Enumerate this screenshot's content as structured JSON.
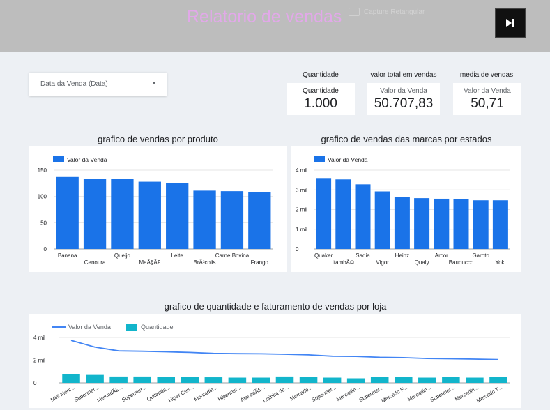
{
  "header": {
    "title": "Relatorio de vendas",
    "ghost_label": "Capture Retangular"
  },
  "filter": {
    "label": "Data da Venda (Data)"
  },
  "kpis": [
    {
      "heading": "Quantidade",
      "label": "Quantidade",
      "value": "1.000"
    },
    {
      "heading": "valor total em vendas",
      "label": "Valor da Venda",
      "value": "50.707,83"
    },
    {
      "heading": "media de vendas",
      "label": "Valor da Venda",
      "value": "50,71"
    }
  ],
  "colors": {
    "bar_blue": "#1a73e8",
    "teal": "#12b5cb",
    "line_blue": "#4285f4"
  },
  "chart_data": [
    {
      "type": "bar",
      "title": "grafico de vendas por produto",
      "legend": "Valor da Venda",
      "categories": [
        "Banana",
        "Cenoura",
        "Queijo",
        "MaÃ§Ã£",
        "Leite",
        "BrÃ³colis",
        "Carne Bovina",
        "Frango"
      ],
      "values": [
        137,
        134,
        134,
        128,
        125,
        111,
        110,
        108
      ],
      "yticks": [
        "0",
        "50",
        "100",
        "150"
      ],
      "ylim": [
        0,
        150
      ]
    },
    {
      "type": "bar",
      "title": "grafico de vendas das marcas por estados",
      "legend": "Valor da Venda",
      "categories": [
        "Quaker",
        "ItambÃ©",
        "Sadia",
        "Vigor",
        "Heinz",
        "Qualy",
        "Arcor",
        "Bauducco",
        "Garoto",
        "Yoki"
      ],
      "values": [
        3600,
        3530,
        3280,
        2920,
        2650,
        2580,
        2550,
        2540,
        2470,
        2470
      ],
      "yticks": [
        "0",
        "1 mil",
        "2 mil",
        "3 mil",
        "4 mil"
      ],
      "ylim": [
        0,
        4000
      ]
    },
    {
      "type": "bar+line",
      "title": "grafico de quantidade e faturamento de vendas por loja",
      "legend_line": "Valor da Venda",
      "legend_bar": "Quantidade",
      "categories": [
        "Mini Merc...",
        "Supermer...",
        "MercadÃ£...",
        "Supermer...",
        "Quitanda...",
        "Hiper Cen...",
        "Mercadin...",
        "Hipermer...",
        "AtacadÃ£...",
        "Lojinha do...",
        "Mercado...",
        "Supermer...",
        "Mercadin...",
        "Supermer...",
        "Mercado F...",
        "Mercadin...",
        "Supermer...",
        "Mercadin...",
        "Mercado T..."
      ],
      "line_values": [
        3750,
        3150,
        2820,
        2790,
        2740,
        2680,
        2600,
        2570,
        2560,
        2520,
        2470,
        2350,
        2330,
        2250,
        2220,
        2150,
        2120,
        2090,
        2050
      ],
      "bar_values": [
        780,
        700,
        560,
        560,
        550,
        520,
        490,
        460,
        460,
        560,
        540,
        460,
        400,
        540,
        520,
        460,
        500,
        460,
        520
      ],
      "yticks": [
        "0",
        "2 mil",
        "4 mil"
      ],
      "ylim": [
        0,
        4000
      ]
    }
  ]
}
